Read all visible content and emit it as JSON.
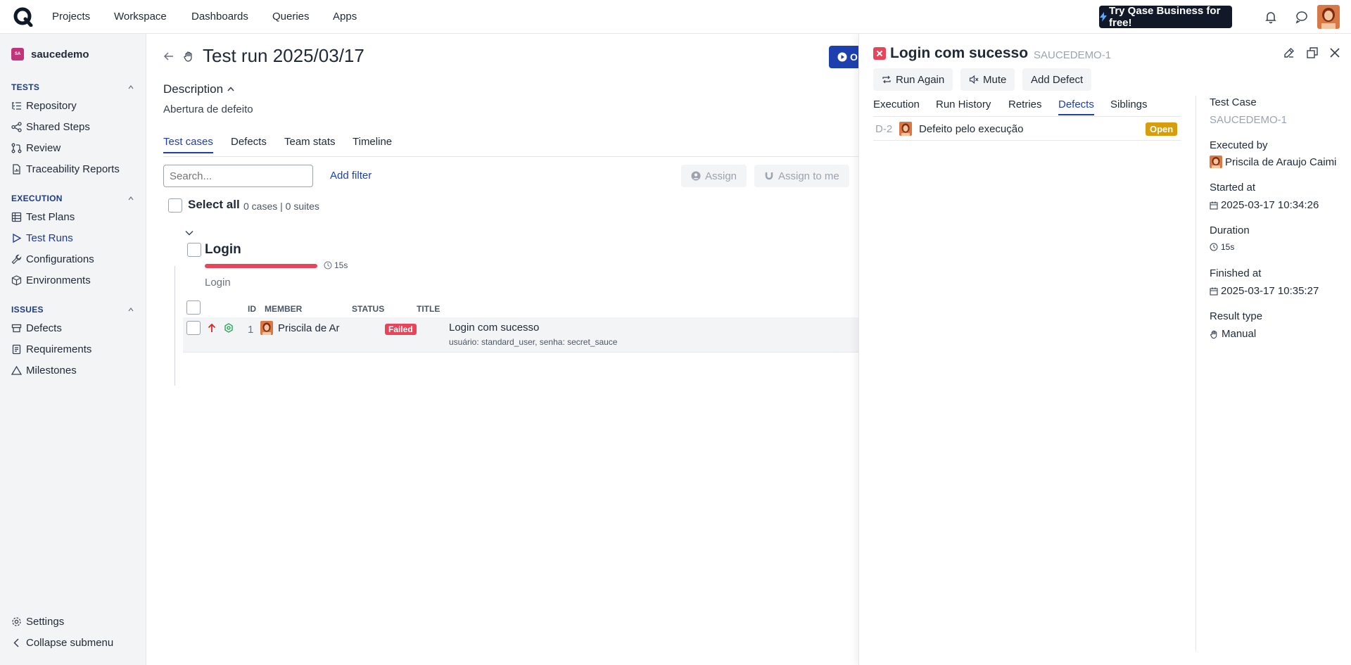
{
  "topbar": {
    "nav": [
      "Projects",
      "Workspace",
      "Dashboards",
      "Queries",
      "Apps"
    ],
    "promo_label": "Try Qase Business for free!"
  },
  "sidebar": {
    "project_badge": "SA",
    "project_name": "saucedemo",
    "sections": {
      "tests": {
        "title": "TESTS",
        "items": [
          "Repository",
          "Shared Steps",
          "Review",
          "Traceability Reports"
        ]
      },
      "execution": {
        "title": "EXECUTION",
        "items": [
          "Test Plans",
          "Test Runs",
          "Configurations",
          "Environments"
        ]
      },
      "issues": {
        "title": "ISSUES",
        "items": [
          "Defects",
          "Requirements",
          "Milestones"
        ]
      }
    },
    "settings_label": "Settings",
    "collapse_label": "Collapse submenu"
  },
  "main": {
    "title": "Test run 2025/03/17",
    "run_button_label": "O",
    "description_heading": "Description",
    "description_text": "Abertura de defeito",
    "tabs": [
      "Test cases",
      "Defects",
      "Team stats",
      "Timeline"
    ],
    "search_placeholder": "Search...",
    "add_filter_label": "Add filter",
    "assign_label": "Assign",
    "assign_to_me_label": "Assign to me",
    "select_all_label": "Select all",
    "cases_count": "0 cases",
    "separator": "|",
    "suites_count": "0 suites",
    "suite": {
      "title": "Login",
      "duration": "15s",
      "subtitle": "Login",
      "progress_failed_fraction": 1.0
    },
    "table": {
      "headers": [
        "ID",
        "MEMBER",
        "STATUS",
        "TITLE"
      ],
      "row": {
        "id": "1",
        "member": "Priscila de Ar",
        "status": "Failed",
        "title": "Login com sucesso",
        "params": "usuário: standard_user, senha: secret_sauce"
      }
    }
  },
  "panel": {
    "title": "Login com sucesso",
    "code": "SAUCEDEMO-1",
    "buttons": [
      "Run Again",
      "Mute",
      "Add Defect"
    ],
    "tabs": [
      "Execution",
      "Run History",
      "Retries",
      "Defects",
      "Siblings"
    ],
    "defect": {
      "id": "D-2",
      "title": "Defeito pelo execução",
      "status": "Open"
    },
    "meta": {
      "test_case_label": "Test Case",
      "test_case_value": "SAUCEDEMO-1",
      "executed_by_label": "Executed by",
      "executed_by_value": "Priscila de Araujo Caimi",
      "started_at_label": "Started at",
      "started_at_value": "2025-03-17 10:34:26",
      "duration_label": "Duration",
      "duration_value": "15s",
      "finished_at_label": "Finished at",
      "finished_at_value": "2025-03-17 10:35:27",
      "result_type_label": "Result type",
      "result_type_value": "Manual"
    }
  },
  "colors": {
    "accent": "#1e40af",
    "failed": "#e8445a",
    "open": "#d69e0e",
    "sidebar_bg": "#f3f4f6"
  }
}
